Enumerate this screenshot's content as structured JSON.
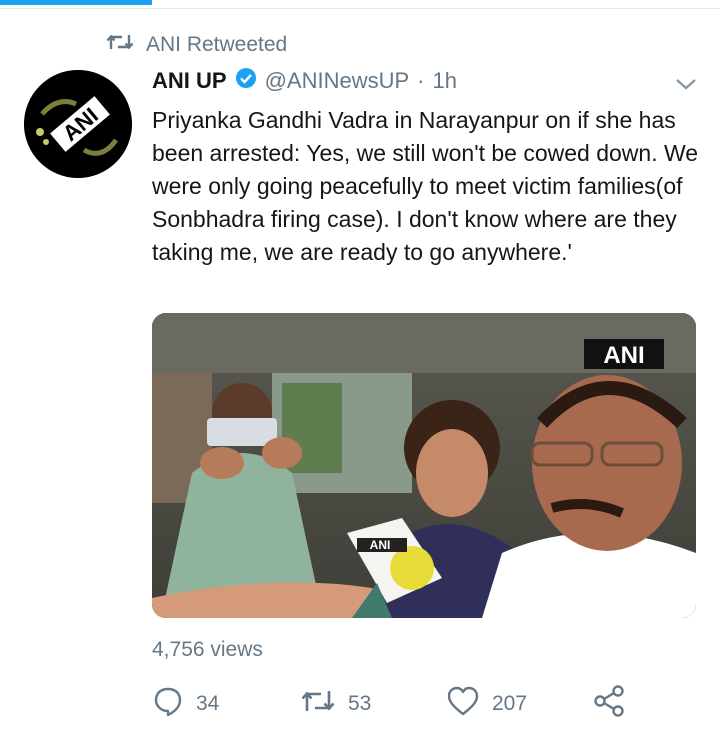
{
  "retweet_label": "ANI Retweeted",
  "tweet": {
    "author_name": "ANI UP",
    "handle": "@ANINewsUP",
    "separator": "·",
    "time": "1h",
    "text": "Priyanka Gandhi Vadra in Narayanpur on if she has been arrested: Yes, we still won't be cowed down. We were only going peacefully to meet victim families(of Sonbhadra firing case). I don't know where are they taking me, we are ready to go anywhere.'",
    "avatar_logo_text": "ANI",
    "media_watermark": "ANI",
    "mic_label": "ANI",
    "views": "4,756 views",
    "replies": "34",
    "retweets": "53",
    "likes": "207"
  },
  "colors": {
    "accent": "#1da1f2",
    "muted": "#657786",
    "text": "#14171a"
  },
  "icons": [
    "retweet-icon",
    "verified-badge-icon",
    "chevron-down-icon",
    "reply-icon",
    "retweet-icon",
    "like-icon",
    "share-icon"
  ]
}
